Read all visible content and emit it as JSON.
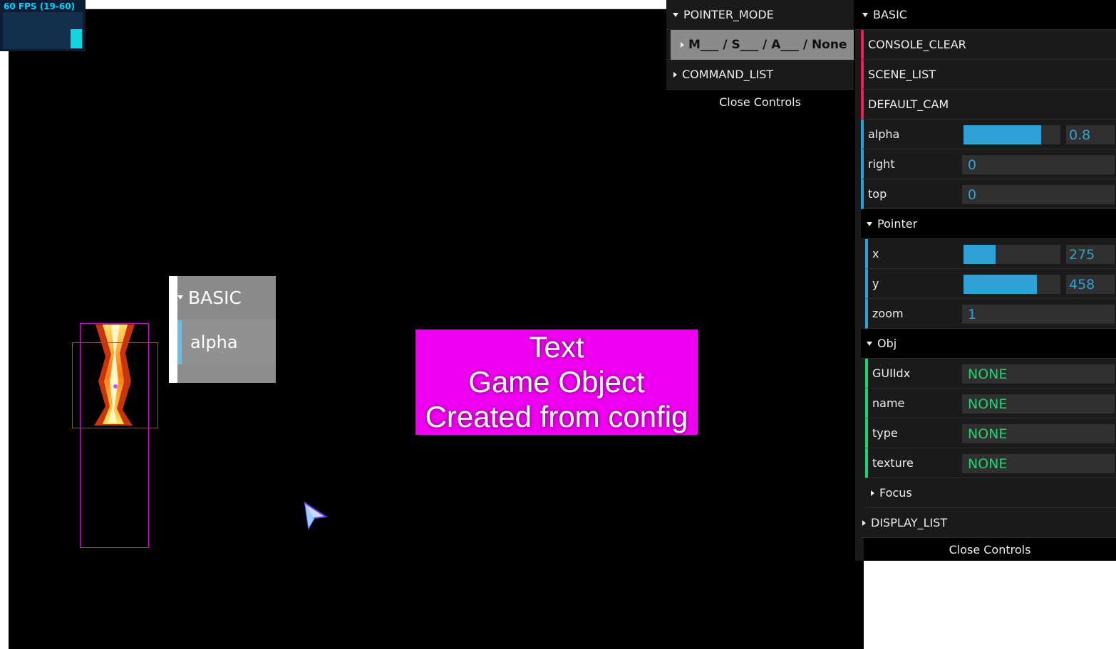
{
  "fps": {
    "label": "60 FPS (19-60)"
  },
  "mini_panel": {
    "folder_label": "BASIC",
    "row_label": "alpha"
  },
  "text_object": {
    "lines": [
      "Text",
      "Game Object",
      "Created from config"
    ]
  },
  "middle_controls": {
    "pointer_mode_label": "POINTER_MODE",
    "selected_mode": "M___ / S___ / A___ / None",
    "command_list_label": "COMMAND_LIST",
    "close_label": "Close Controls"
  },
  "right_controls": {
    "basic_label": "BASIC",
    "console_clear": "CONSOLE_CLEAR",
    "scene_list": "SCENE_LIST",
    "default_cam": "DEFAULT_CAM",
    "alpha": {
      "label": "alpha",
      "value": "0.8",
      "fraction": 0.8
    },
    "right": {
      "label": "right",
      "value": "0"
    },
    "top": {
      "label": "top",
      "value": "0"
    },
    "pointer_label": "Pointer",
    "x": {
      "label": "x",
      "value": "275",
      "fraction": 0.33
    },
    "y": {
      "label": "y",
      "value": "458",
      "fraction": 0.76
    },
    "zoom": {
      "label": "zoom",
      "value": "1"
    },
    "obj_label": "Obj",
    "guiidx": {
      "label": "GUIIdx",
      "value": "NONE"
    },
    "name": {
      "label": "name",
      "value": "NONE"
    },
    "type": {
      "label": "type",
      "value": "NONE"
    },
    "texture": {
      "label": "texture",
      "value": "NONE"
    },
    "focus_label": "Focus",
    "display_list_label": "DISPLAY_LIST",
    "close_label": "Close Controls"
  },
  "colors": {
    "canvas": "#000000",
    "text_object_bg": "#f000f0",
    "accent_blue": "#2fa1d6",
    "accent_red": "#e8215a",
    "accent_green": "#1ed36f"
  }
}
